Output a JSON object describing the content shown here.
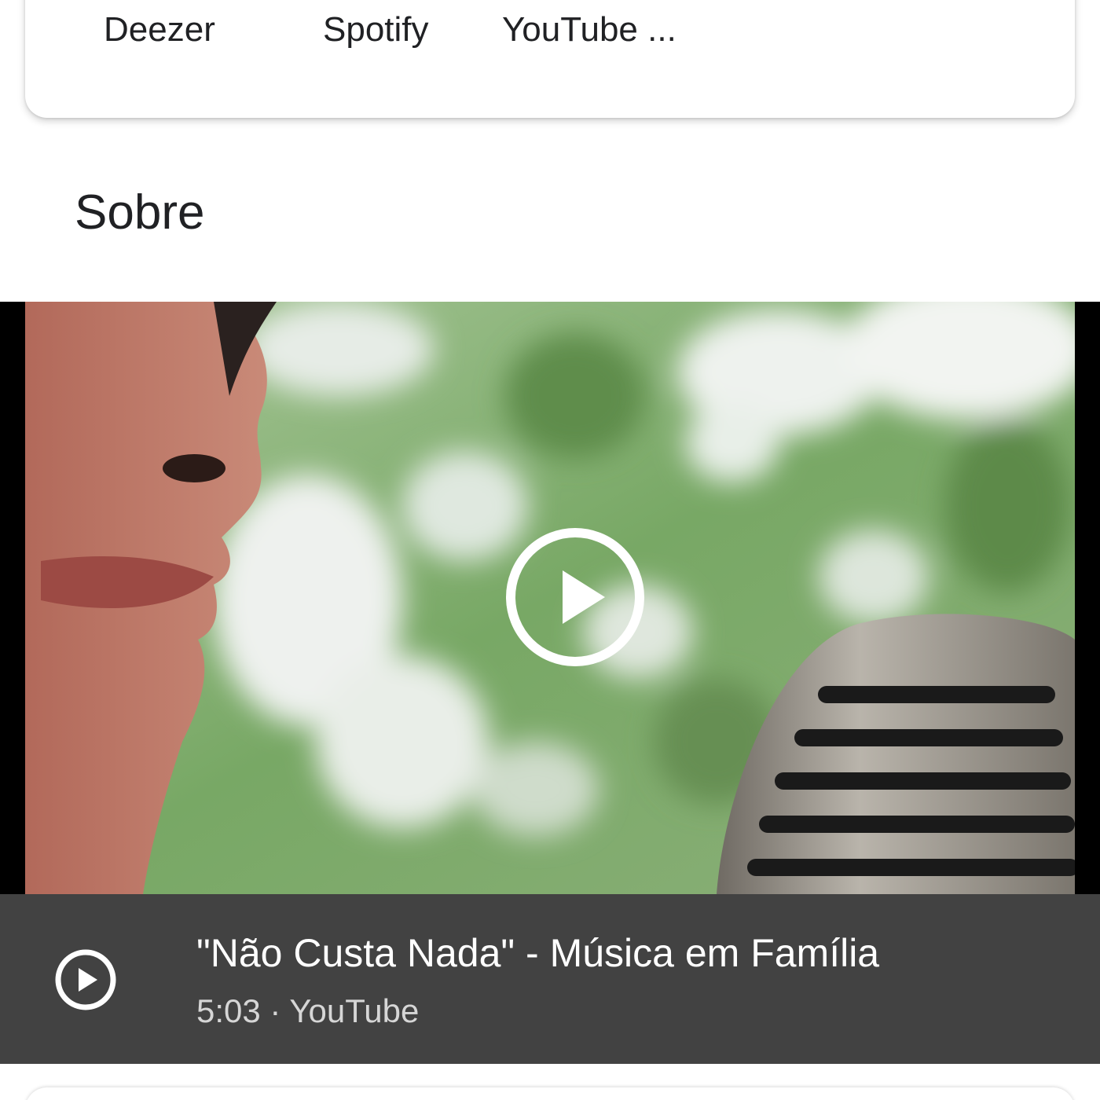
{
  "services": {
    "items": [
      {
        "label": "Deezer"
      },
      {
        "label": "Spotify"
      },
      {
        "label": "YouTube ..."
      }
    ]
  },
  "about": {
    "title": "Sobre"
  },
  "video": {
    "title": "\"Não Custa Nada\" - Música em Família",
    "duration": "5:03",
    "separator": " · ",
    "source": "YouTube",
    "colors": {
      "caption_bg": "#424242",
      "foliage": "#6e9a5a"
    }
  }
}
